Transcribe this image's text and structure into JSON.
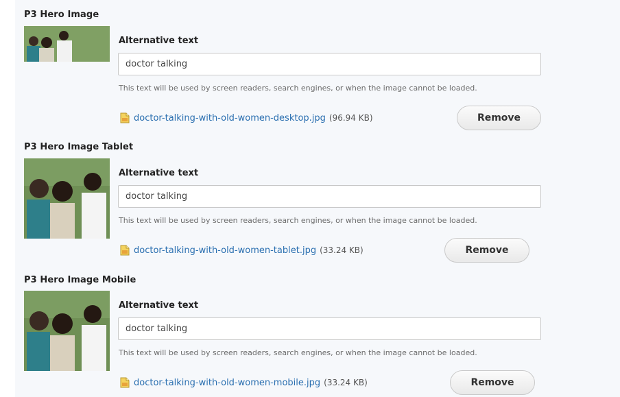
{
  "sections": [
    {
      "title": "P3 Hero Image",
      "alt_label": "Alternative text",
      "alt_value": "doctor talking",
      "help": "This text will be used by screen readers, search engines, or when the image cannot be loaded.",
      "file_name": "doctor-talking-with-old-women-desktop.jpg",
      "file_size": "(96.94 KB)",
      "remove_label": "Remove"
    },
    {
      "title": "P3 Hero Image Tablet",
      "alt_label": "Alternative text",
      "alt_value": "doctor talking",
      "help": "This text will be used by screen readers, search engines, or when the image cannot be loaded.",
      "file_name": "doctor-talking-with-old-women-tablet.jpg",
      "file_size": "(33.24 KB)",
      "remove_label": "Remove"
    },
    {
      "title": "P3 Hero Image Mobile",
      "alt_label": "Alternative text",
      "alt_value": "doctor talking",
      "help": "This text will be used by screen readers, search engines, or when the image cannot be loaded.",
      "file_name": "doctor-talking-with-old-women-mobile.jpg",
      "file_size": "(33.24 KB)",
      "remove_label": "Remove"
    }
  ],
  "icons": {
    "file": "image-file-icon"
  },
  "colors": {
    "link": "#2a6fb0",
    "background": "#f6f8fb"
  }
}
